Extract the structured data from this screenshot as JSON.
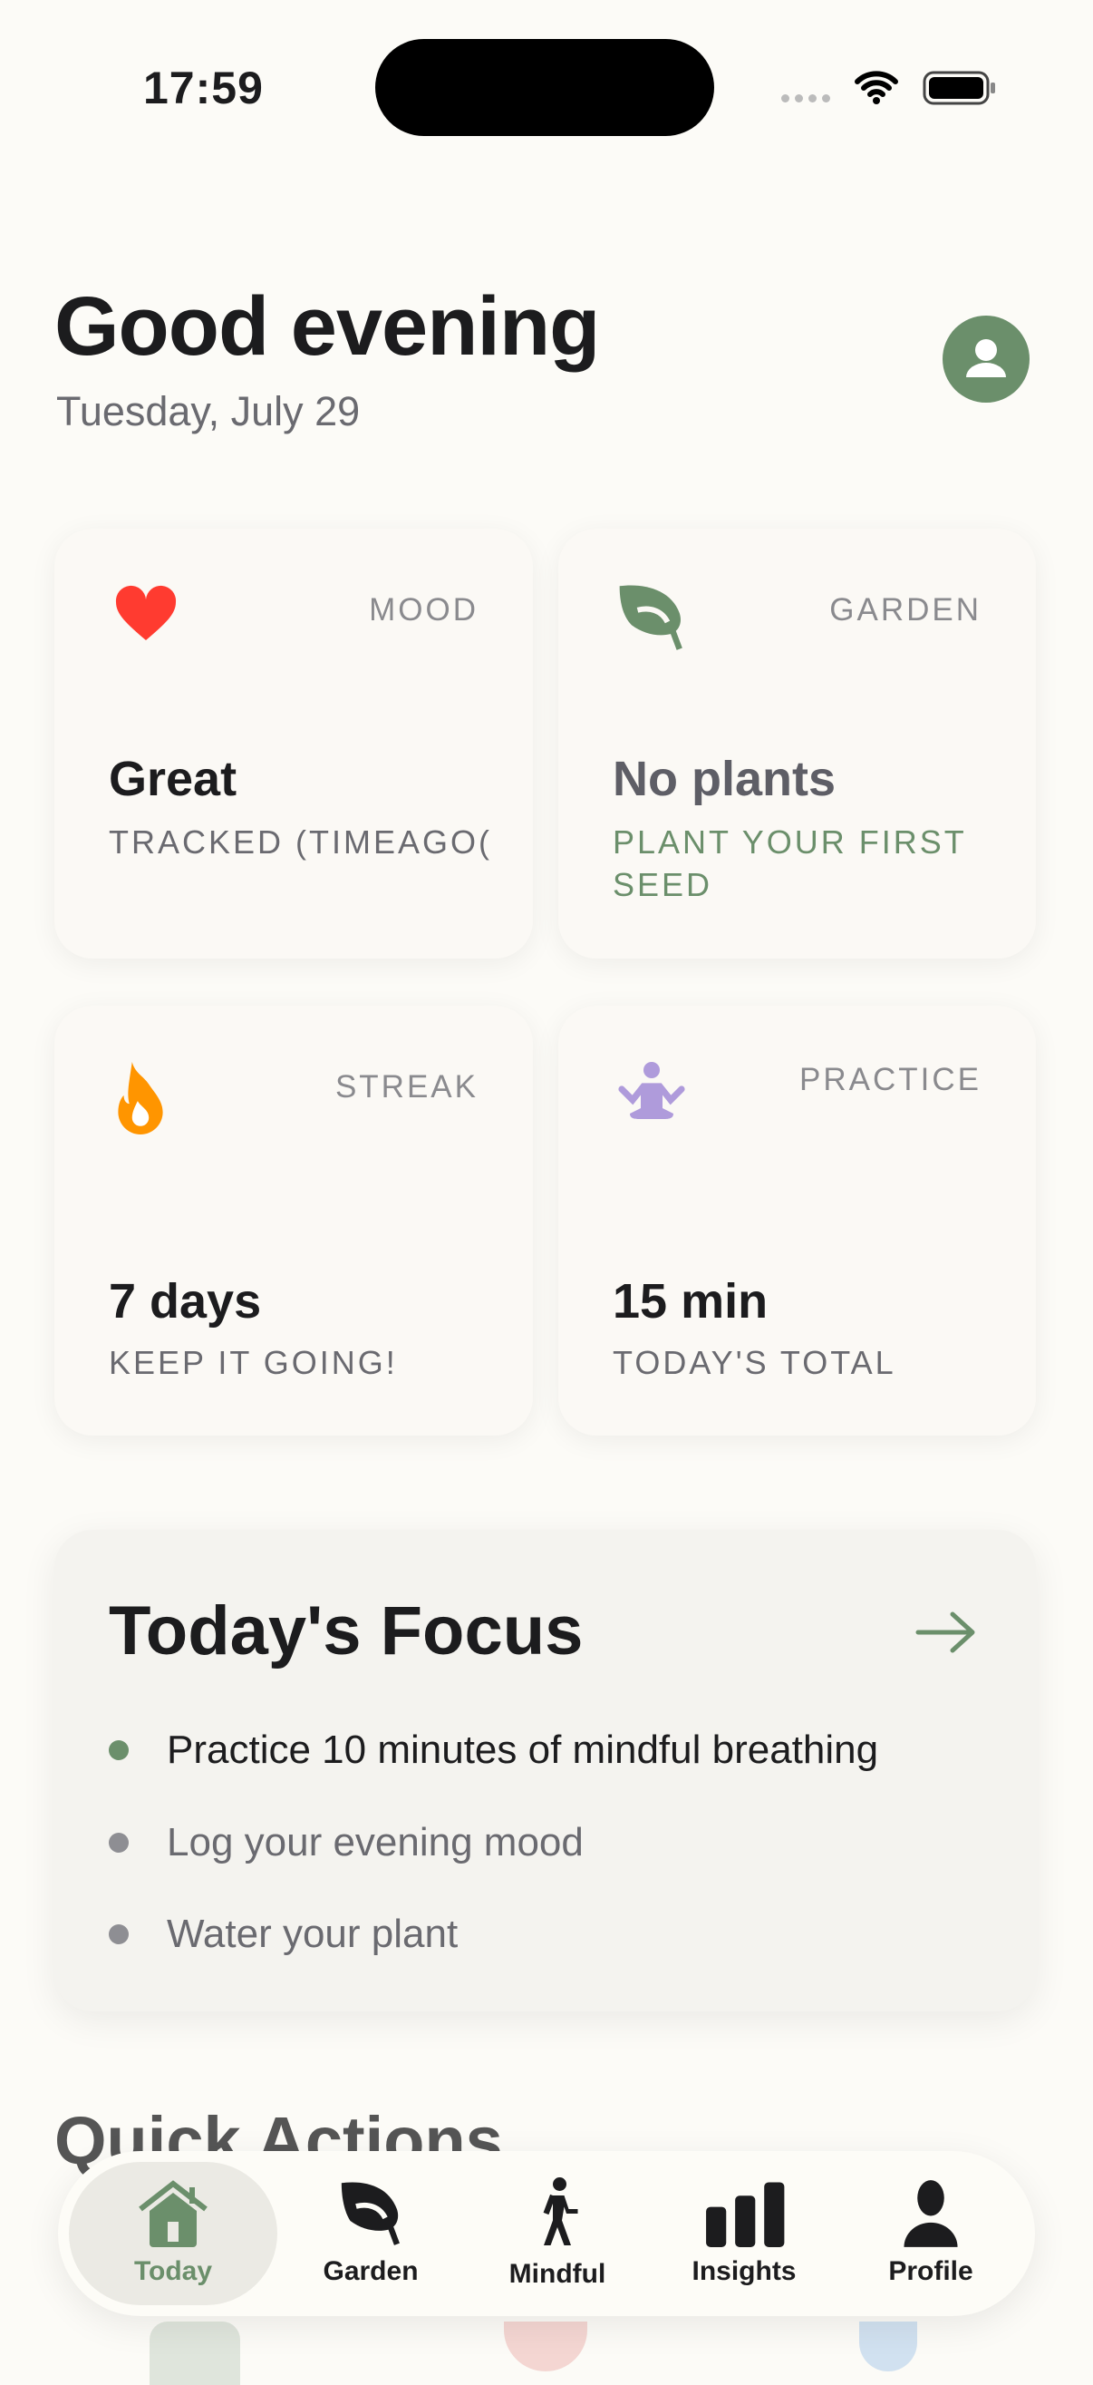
{
  "status_bar": {
    "time": "17:59"
  },
  "header": {
    "greeting": "Good evening",
    "date": "Tuesday, July 29"
  },
  "cards": [
    {
      "label": "MOOD",
      "value": "Great",
      "sub": "TRACKED (TIMEAGO(CURRE…",
      "icon": "heart-icon",
      "color": "#ff3b30"
    },
    {
      "label": "GARDEN",
      "value": "No plants",
      "sub": "PLANT YOUR FIRST SEED",
      "icon": "leaf-icon",
      "color": "#6b8f6b"
    },
    {
      "label": "STREAK",
      "value": "7 days",
      "sub": "KEEP IT GOING!",
      "icon": "flame-icon",
      "color": "#ff9500"
    },
    {
      "label": "PRACTICE",
      "value": "15 min",
      "sub": "TODAY'S TOTAL",
      "icon": "meditation-icon",
      "color": "#af9bdb"
    }
  ],
  "focus": {
    "title": "Today's Focus",
    "items": [
      "Practice 10 minutes of mindful breathing",
      "Log your evening mood",
      "Water your plant"
    ]
  },
  "quick_actions": {
    "title": "Quick Actions"
  },
  "tabs": [
    {
      "label": "Today",
      "active": true
    },
    {
      "label": "Garden"
    },
    {
      "label": "Mindful"
    },
    {
      "label": "Insights"
    },
    {
      "label": "Profile"
    }
  ],
  "colors": {
    "accent": "#6b8f6b",
    "background": "#fcfbf7"
  }
}
